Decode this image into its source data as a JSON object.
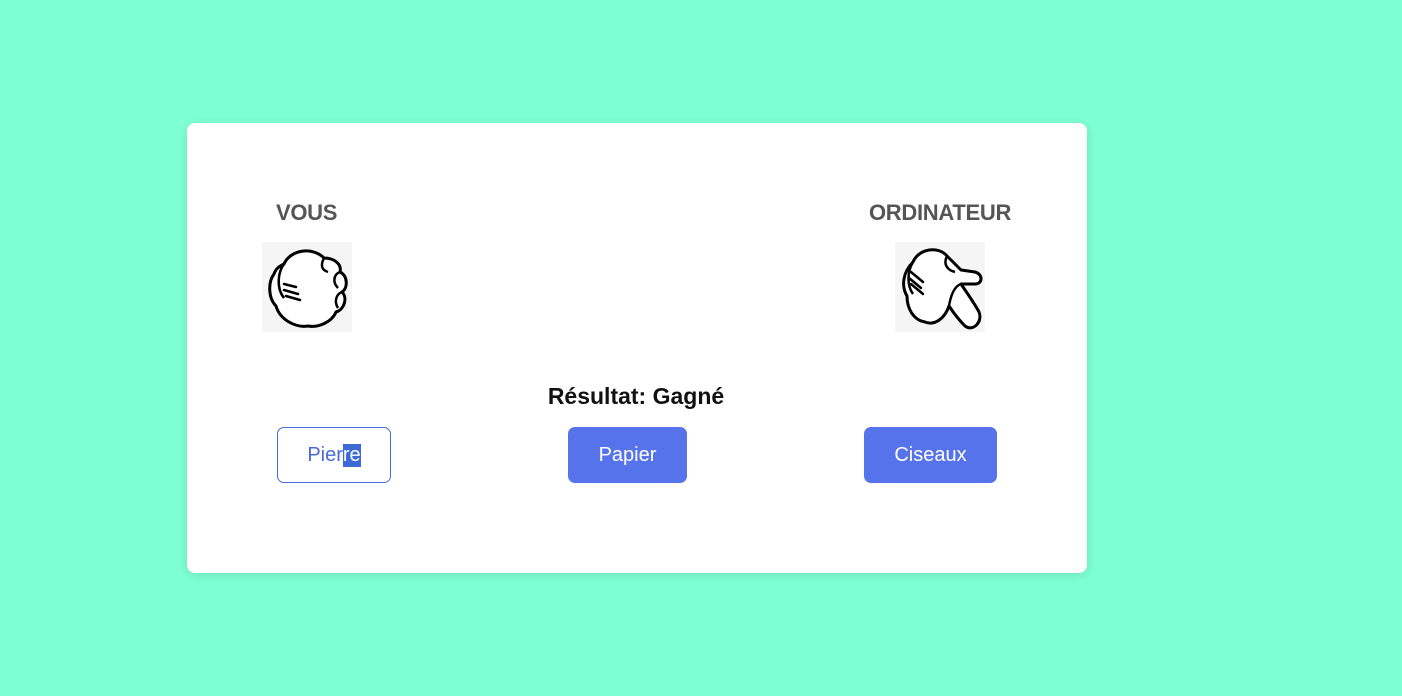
{
  "colors": {
    "background": "#7fffd4",
    "card": "#ffffff",
    "accent": "#5673ec",
    "label": "#555555"
  },
  "players": {
    "you": {
      "label": "VOUS",
      "icon": "rock-hand-icon"
    },
    "computer": {
      "label": "ORDINATEUR",
      "icon": "scissors-hand-icon"
    }
  },
  "result": "Résultat: Gagné",
  "buttons": {
    "pierre_part1": "Pier",
    "pierre_part2": "re",
    "papier": "Papier",
    "ciseaux": "Ciseaux"
  }
}
